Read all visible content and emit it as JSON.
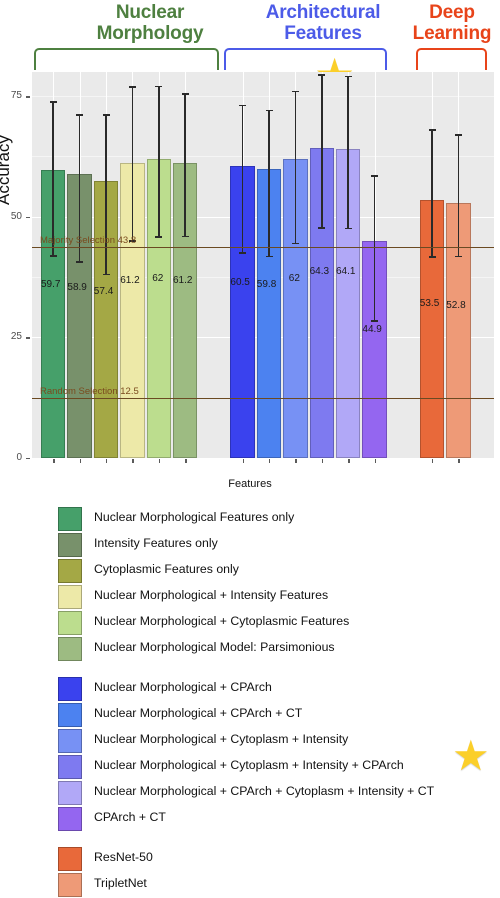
{
  "chart_data": {
    "type": "bar",
    "title": "",
    "xlabel": "Features",
    "ylabel": "Accuracy",
    "ylim": [
      0,
      80
    ],
    "yticks": [
      0,
      25,
      50,
      75
    ],
    "grid": true,
    "legend_position": "bottom",
    "group_titles": [
      "Nuclear Morphology",
      "Architectural Features",
      "Deep Learning"
    ],
    "group_colors": [
      "#4E8040",
      "#4C5BE8",
      "#E8441A"
    ],
    "reference_lines": [
      {
        "label": "Majority Selection",
        "value": "43.8",
        "y": 43.8
      },
      {
        "label": "Random Selection",
        "value": "12.5",
        "y": 12.5
      }
    ],
    "annotations": [
      {
        "name": "star",
        "target": "Nuclear Morphological + Cytoplasm + Intensity + CPArch"
      }
    ],
    "series": [
      {
        "group": 0,
        "label": "Nuclear Morphological Features only",
        "value": 59.7,
        "value_text": "59.7",
        "err_low": 42.0,
        "err_high": 74.0,
        "color": "#46A06A"
      },
      {
        "group": 0,
        "label": "Intensity Features only",
        "value": 58.9,
        "value_text": "58.9",
        "err_low": 40.8,
        "err_high": 71.2,
        "color": "#78916B"
      },
      {
        "group": 0,
        "label": "Cytoplasmic Features only",
        "value": 57.4,
        "value_text": "57.4",
        "err_low": 38.2,
        "err_high": 71.2,
        "color": "#A4A845"
      },
      {
        "group": 0,
        "label": "Nuclear Morphological + Intensity Features",
        "value": 61.2,
        "value_text": "61.2",
        "err_low": 45.1,
        "err_high": 77.0,
        "color": "#EDE9A8"
      },
      {
        "group": 0,
        "label": "Nuclear Morphological + Cytoplasmic Features",
        "value": 62.0,
        "value_text": "62",
        "err_low": 46.0,
        "err_high": 77.2,
        "color": "#BCDD8E"
      },
      {
        "group": 0,
        "label": "Nuclear Morphological Model: Parsimonious",
        "value": 61.2,
        "value_text": "61.2",
        "err_low": 46.1,
        "err_high": 75.6,
        "color": "#9DBB82"
      },
      {
        "group": 1,
        "label": "Nuclear Morphological + CPArch",
        "value": 60.5,
        "value_text": "60.5",
        "err_low": 42.7,
        "err_high": 73.2,
        "color": "#3A42EE"
      },
      {
        "group": 1,
        "label": "Nuclear Morphological + CPArch + CT",
        "value": 59.8,
        "value_text": "59.8",
        "err_low": 41.9,
        "err_high": 72.2,
        "color": "#4C82F0"
      },
      {
        "group": 1,
        "label": "Nuclear Morphological + Cytoplasm + Intensity",
        "value": 62.0,
        "value_text": "62",
        "err_low": 44.6,
        "err_high": 76.1,
        "color": "#7791F4"
      },
      {
        "group": 1,
        "label": "Nuclear Morphological + Cytoplasm + Intensity + CPArch",
        "value": 64.3,
        "value_text": "64.3",
        "err_low": 47.8,
        "err_high": 79.5,
        "color": "#7E7AF0"
      },
      {
        "group": 1,
        "label": "Nuclear Morphological + CPArch + Cytoplasm + Intensity + CT",
        "value": 64.1,
        "value_text": "64.1",
        "err_low": 47.7,
        "err_high": 79.2,
        "color": "#B1A8F7"
      },
      {
        "group": 1,
        "label": "CPArch + CT",
        "value": 44.9,
        "value_text": "44.9",
        "err_low": 28.5,
        "err_high": 58.6,
        "color": "#9466F0"
      },
      {
        "group": 2,
        "label": "ResNet-50",
        "value": 53.5,
        "value_text": "53.5",
        "err_low": 41.8,
        "err_high": 68.1,
        "color": "#E8693A"
      },
      {
        "group": 2,
        "label": "TripletNet",
        "value": 52.8,
        "value_text": "52.8",
        "err_low": 41.9,
        "err_high": 67.1,
        "color": "#EE9A77"
      }
    ]
  },
  "legend": {
    "groups": [
      {
        "items": [
          {
            "label": "Nuclear Morphological Features only",
            "color": "#46A06A"
          },
          {
            "label": "Intensity Features only",
            "color": "#78916B"
          },
          {
            "label": "Cytoplasmic Features only",
            "color": "#A4A845"
          },
          {
            "label": "Nuclear Morphological + Intensity Features",
            "color": "#EDE9A8"
          },
          {
            "label": "Nuclear Morphological + Cytoplasmic Features",
            "color": "#BCDD8E"
          },
          {
            "label": "Nuclear Morphological Model: Parsimonious",
            "color": "#9DBB82"
          }
        ]
      },
      {
        "items": [
          {
            "label": "Nuclear Morphological + CPArch",
            "color": "#3A42EE"
          },
          {
            "label": "Nuclear Morphological + CPArch + CT",
            "color": "#4C82F0"
          },
          {
            "label": "Nuclear Morphological + Cytoplasm + Intensity",
            "color": "#7791F4"
          },
          {
            "label": "Nuclear Morphological + Cytoplasm + Intensity + CPArch",
            "color": "#7E7AF0"
          },
          {
            "label": "Nuclear Morphological + CPArch + Cytoplasm + Intensity + CT",
            "color": "#B1A8F7"
          },
          {
            "label": "CPArch + CT",
            "color": "#9466F0"
          }
        ]
      },
      {
        "items": [
          {
            "label": "ResNet-50",
            "color": "#E8693A"
          },
          {
            "label": "TripletNet",
            "color": "#EE9A77"
          }
        ]
      }
    ]
  },
  "icons": {
    "star": "★"
  }
}
